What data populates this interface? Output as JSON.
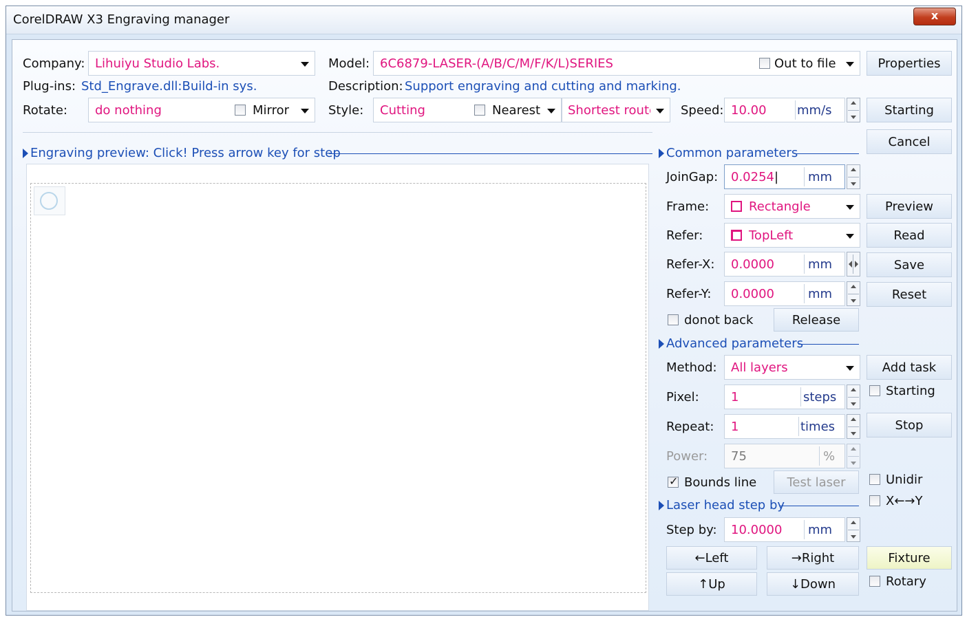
{
  "window": {
    "title": "CorelDRAW X3 Engraving manager",
    "close_label": "x"
  },
  "top": {
    "company_label": "Company:",
    "company_value": "Lihuiyu Studio Labs.",
    "model_label": "Model:",
    "model_value": "6C6879-LASER-(A/B/C/M/F/K/L)SERIES",
    "out_to_file_label": "Out to file",
    "out_to_file_checked": false,
    "properties_label": "Properties",
    "plugins_label": "Plug-ins:",
    "plugins_value": "Std_Engrave.dll:Build-in sys.",
    "description_label": "Description:",
    "description_value": "Support engraving and cutting and marking.",
    "rotate_label": "Rotate:",
    "rotate_value": "do nothing",
    "mirror_label": "Mirror",
    "mirror_checked": false,
    "style_label": "Style:",
    "style_value": "Cutting",
    "nearest_label": "Nearest",
    "nearest_checked": false,
    "route_value": "Shortest route",
    "speed_label": "Speed:",
    "speed_value": "10.00",
    "speed_unit": "mm/s",
    "starting_label": "Starting",
    "cancel_label": "Cancel"
  },
  "preview": {
    "header": "Engraving preview: Click! Press arrow key for step"
  },
  "common": {
    "header": "Common parameters",
    "joingap_label": "JoinGap:",
    "joingap_value": "0.0254",
    "joingap_unit": "mm",
    "frame_label": "Frame:",
    "frame_value": "Rectangle",
    "refer_label": "Refer:",
    "refer_value": "TopLeft",
    "referx_label": "Refer-X:",
    "referx_value": "0.0000",
    "referx_unit": "mm",
    "refery_label": "Refer-Y:",
    "refery_value": "0.0000",
    "refery_unit": "mm",
    "donotback_label": "donot back",
    "donotback_checked": false,
    "release_label": "Release",
    "preview_label": "Preview",
    "read_label": "Read",
    "save_label": "Save",
    "reset_label": "Reset"
  },
  "advanced": {
    "header": "Advanced parameters",
    "method_label": "Method:",
    "method_value": "All layers",
    "pixel_label": "Pixel:",
    "pixel_value": "1",
    "pixel_unit": "steps",
    "repeat_label": "Repeat:",
    "repeat_value": "1",
    "repeat_unit": "times",
    "power_label": "Power:",
    "power_value": "75",
    "power_unit": "%",
    "bounds_label": "Bounds line",
    "bounds_checked": true,
    "test_laser_label": "Test laser",
    "add_task_label": "Add task",
    "starting_cb_label": "Starting",
    "starting_cb_checked": false,
    "stop_label": "Stop",
    "unidir_label": "Unidir",
    "unidir_checked": false,
    "xy_label": "X←→Y",
    "xy_checked": false
  },
  "step": {
    "header": "Laser head step by",
    "stepby_label": "Step by:",
    "stepby_value": "10.0000",
    "stepby_unit": "mm",
    "left_label": "←Left",
    "right_label": "→Right",
    "up_label": "↑Up",
    "down_label": "↓Down",
    "fixture_label": "Fixture",
    "rotary_label": "Rotary",
    "rotary_checked": false
  },
  "colors": {
    "value_text": "#e0157f",
    "accent_blue": "#1c4fb6",
    "unit_blue": "#233a8c"
  }
}
